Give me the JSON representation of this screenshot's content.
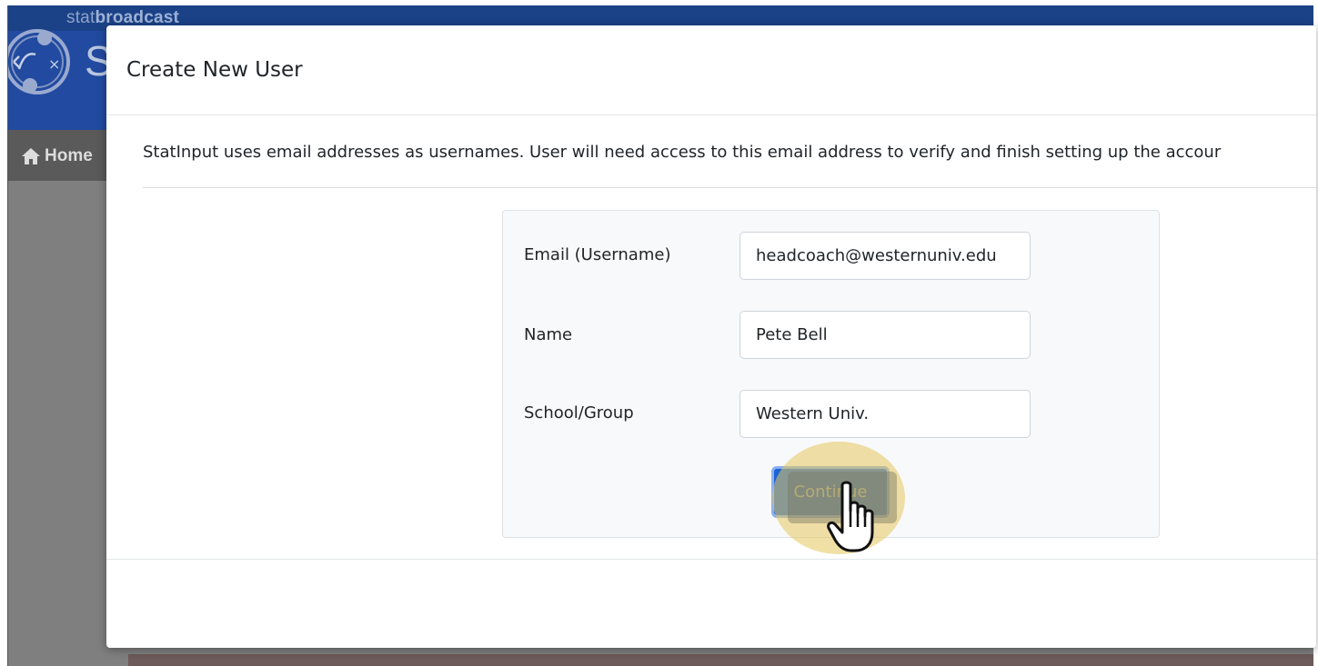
{
  "app": {
    "brand_prefix": "stat",
    "brand_suffix": "broadcast",
    "logo_letter": "S",
    "nav_home_label": "Home"
  },
  "modal": {
    "title": "Create New User",
    "intro": "StatInput uses email addresses as usernames. User will need access to this email address to verify and finish setting up the accour",
    "form": {
      "email_label": "Email (Username)",
      "email_value": "headcoach@westernuniv.edu",
      "name_label": "Name",
      "name_value": "Pete Bell",
      "school_label": "School/Group",
      "school_value": "Western Univ.",
      "continue_label": "Continue"
    }
  },
  "colors": {
    "header_blue": "#214aa0",
    "primary_button": "#1d63d6",
    "click_highlight": "#e6c65c"
  },
  "icons": {
    "home": "home-icon",
    "logo": "statbroadcast-logo-icon",
    "cursor": "hand-pointer-cursor-icon"
  }
}
